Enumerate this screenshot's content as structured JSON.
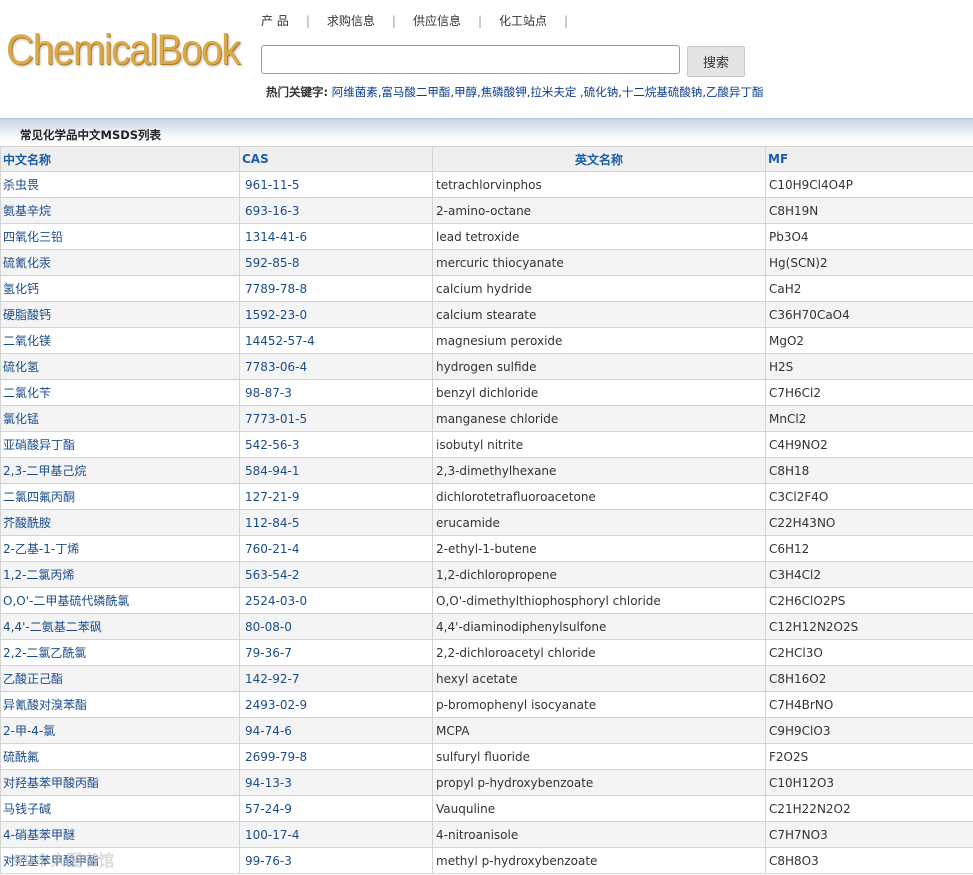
{
  "logo": "ChemicalBook",
  "nav": [
    "产 品",
    "求购信息",
    "供应信息",
    "化工站点"
  ],
  "search": {
    "value": "",
    "placeholder": "",
    "button_label": "搜索"
  },
  "hot_keywords": {
    "label": "热门关键字:",
    "items": [
      "阿维菌素",
      "富马酸二甲酯",
      "甲醇",
      "焦磷酸钾",
      "拉米夫定 ",
      "硫化钠",
      "十二烷基硫酸钠",
      "乙酸异丁酯"
    ]
  },
  "section_title": "常见化学品中文MSDS列表",
  "table": {
    "headers": [
      "中文名称",
      "CAS",
      "英文名称",
      "MF"
    ],
    "rows": [
      [
        "杀虫畏",
        "961-11-5",
        "tetrachlorvinphos",
        "C10H9Cl4O4P"
      ],
      [
        "氨基辛烷",
        "693-16-3",
        "2-amino-octane",
        "C8H19N"
      ],
      [
        "四氧化三铅",
        "1314-41-6",
        "lead tetroxide",
        "Pb3O4"
      ],
      [
        "硫氰化汞",
        "592-85-8",
        "mercuric thiocyanate",
        "Hg(SCN)2"
      ],
      [
        "氢化钙",
        "7789-78-8",
        "calcium hydride",
        "CaH2"
      ],
      [
        "硬脂酸钙",
        "1592-23-0",
        "calcium stearate",
        "C36H70CaO4"
      ],
      [
        "二氧化镁",
        "14452-57-4",
        "magnesium peroxide",
        "MgO2"
      ],
      [
        "硫化氢",
        "7783-06-4",
        "hydrogen sulfide",
        "H2S"
      ],
      [
        "二氯化苄",
        "98-87-3",
        "benzyl dichloride",
        "C7H6Cl2"
      ],
      [
        "氯化锰",
        "7773-01-5",
        "manganese chloride",
        "MnCl2"
      ],
      [
        "亚硝酸异丁酯",
        "542-56-3",
        "isobutyl nitrite",
        "C4H9NO2"
      ],
      [
        "2,3-二甲基己烷",
        "584-94-1",
        "2,3-dimethylhexane",
        "C8H18"
      ],
      [
        "二氯四氟丙酮",
        "127-21-9",
        "dichlorotetrafluoroacetone",
        "C3Cl2F4O"
      ],
      [
        "芥酸酰胺",
        "112-84-5",
        "erucamide",
        "C22H43NO"
      ],
      [
        "2-乙基-1-丁烯",
        "760-21-4",
        "2-ethyl-1-butene",
        "C6H12"
      ],
      [
        "1,2-二氯丙烯",
        "563-54-2",
        "1,2-dichloropropene",
        "C3H4Cl2"
      ],
      [
        "O,O'-二甲基硫代磷酰氯",
        "2524-03-0",
        "O,O'-dimethylthiophosphoryl chloride",
        "C2H6ClO2PS"
      ],
      [
        "4,4'-二氨基二苯砜",
        "80-08-0",
        "4,4'-diaminodiphenylsulfone",
        "C12H12N2O2S"
      ],
      [
        "2,2-二氯乙酰氯",
        "79-36-7",
        "2,2-dichloroacetyl chloride",
        "C2HCl3O"
      ],
      [
        "乙酸正己酯",
        "142-92-7",
        "hexyl acetate",
        "C8H16O2"
      ],
      [
        "异氰酸对溴苯酯",
        "2493-02-9",
        "p-bromophenyl isocyanate",
        "C7H4BrNO"
      ],
      [
        "2-甲-4-氯",
        "94-74-6",
        "MCPA",
        "C9H9ClO3"
      ],
      [
        "硫酰氟",
        "2699-79-8",
        "sulfuryl fluoride",
        "F2O2S"
      ],
      [
        "对羟基苯甲酸丙酯",
        "94-13-3",
        "propyl p-hydroxybenzoate",
        "C10H12O3"
      ],
      [
        "马钱子碱",
        "57-24-9",
        "Vauquline",
        "C21H22N2O2"
      ],
      [
        "4-硝基苯甲醚",
        "100-17-4",
        "4-nitroanisole",
        "C7H7NO3"
      ],
      [
        "对羟基苯甲酸甲酯",
        "99-76-3",
        "methyl p-hydroxybenzoate",
        "C8H8O3"
      ]
    ]
  },
  "watermark": "99个人图书馆"
}
